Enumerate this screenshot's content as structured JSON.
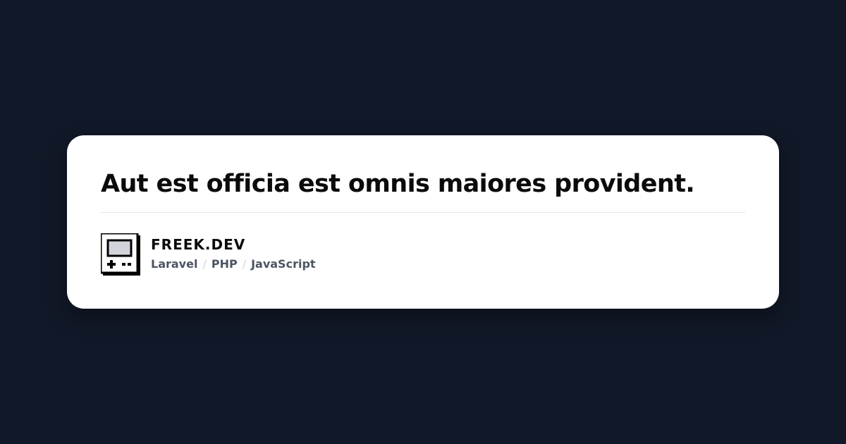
{
  "post": {
    "title": "Aut est officia est omnis maiores provident."
  },
  "brand": {
    "logo_icon": "retro-computer-icon",
    "name": "FREEK.DEV",
    "tags": [
      "Laravel",
      "PHP",
      "JavaScript"
    ],
    "separator": "/"
  },
  "colors": {
    "background": "#111827",
    "card": "#ffffff",
    "title_text": "#0b0b0b",
    "tag_text": "#4b5563",
    "separator": "#d1d5db",
    "divider": "#e5e7eb"
  }
}
